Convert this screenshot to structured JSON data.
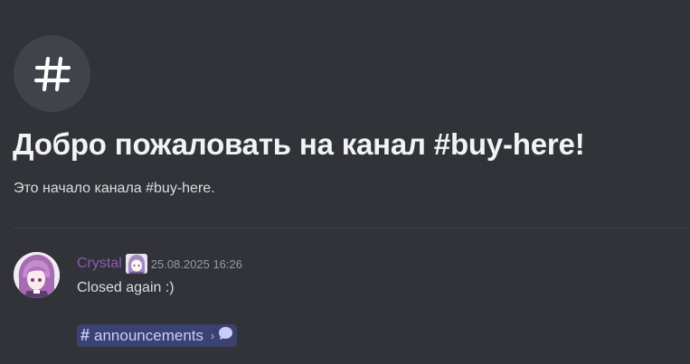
{
  "welcome": {
    "title": "Добро пожаловать на канал #buy-here!",
    "subtitle": "Это начало канала #buy-here."
  },
  "message": {
    "username": "Crystal",
    "timestamp": "25.08.2025 16:26",
    "text": "Closed again :)",
    "channel_mention": {
      "label": "announcements",
      "icon": "hash-icon",
      "chevron_icon": "chevron-right-icon",
      "thread_icon": "speech-bubble-icon"
    }
  },
  "colors": {
    "background": "#313338",
    "username": "#8e59b3",
    "mention_background": "#3c4270",
    "mention_text": "#c9cdfb"
  }
}
